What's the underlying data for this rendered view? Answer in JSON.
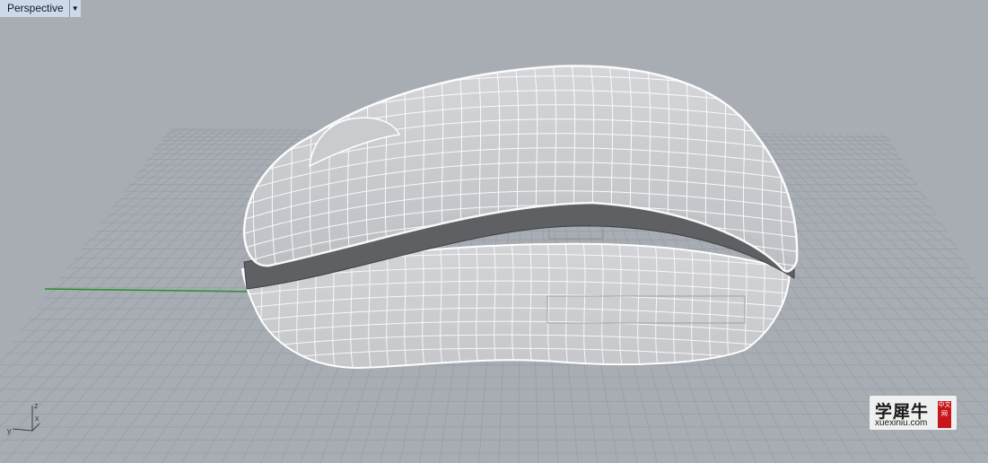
{
  "viewport": {
    "name": "Perspective",
    "menu_icon": "triangle-down-icon"
  },
  "axes": {
    "x": "x",
    "y": "y",
    "z": "z"
  },
  "watermark": {
    "cn": "学犀牛",
    "en": "xuexiniu.com",
    "seal": "中文网"
  },
  "colors": {
    "background": "#a8adb4",
    "grid": "#989ea6",
    "x_axis": "#2a8f2a",
    "model_wire": "#ffffff",
    "model_fill": "#c4c6ca"
  }
}
